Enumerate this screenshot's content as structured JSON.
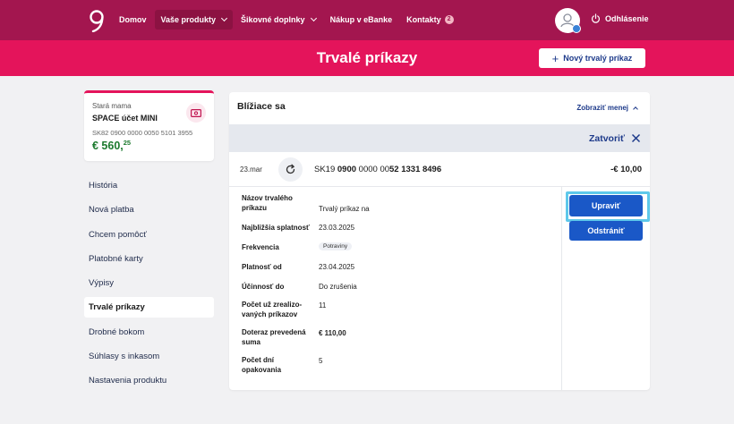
{
  "nav": {
    "items": [
      {
        "label": "Domov"
      },
      {
        "label": "Vaše produkty"
      },
      {
        "label": "Šikovné doplnky"
      },
      {
        "label": "Nákup v eBanke"
      },
      {
        "label": "Kontakty"
      }
    ],
    "contacts_badge": "2",
    "logout_label": "Odhlásenie"
  },
  "page": {
    "title": "Trvalé príkazy",
    "new_order_label": "Nový trvalý príkaz"
  },
  "account": {
    "nickname": "Stará mama",
    "name": "SPACE účet MINI",
    "iban": "SK82 0900 0000 0050 5101 3955",
    "balance_main": "€ 560,",
    "balance_cents": "25"
  },
  "sidebar": {
    "items": [
      {
        "label": "História"
      },
      {
        "label": "Nová platba"
      },
      {
        "label": "Chcem pomôcť"
      },
      {
        "label": "Platobné karty"
      },
      {
        "label": "Výpisy"
      },
      {
        "label": "Trvalé príkazy"
      },
      {
        "label": "Drobné bokom"
      },
      {
        "label": "Súhlasy s inkasom"
      },
      {
        "label": "Nastavenia produktu"
      }
    ]
  },
  "panel": {
    "title": "Blížiace sa",
    "show_less_label": "Zobraziť menej",
    "close_label": "Zatvoriť",
    "order": {
      "date": "23.mar",
      "iban_prefix": "SK19 ",
      "iban_bold1": "0900",
      "iban_mid": " 0000 00",
      "iban_bold2": "52 1331 8496",
      "amount": "-€ 10,00"
    },
    "details": [
      {
        "label": "Názov trvalého príkazu",
        "value": "Trvalý príkaz na"
      },
      {
        "label": "Najbližšia splatnosť",
        "value": "23.03.2025"
      },
      {
        "label": "Frekvencia",
        "value": "Potraviny"
      },
      {
        "label": "Platnosť od",
        "value": "23.04.2025"
      },
      {
        "label": "Účinnosť do",
        "value": "Do zrušenia"
      },
      {
        "label": "Počet už zrealizovaných príkazov",
        "label_line1": "Počet už zrealizo-",
        "label_line2": "vaných príkazov",
        "value": "11"
      },
      {
        "label": "Doteraz prevedená suma",
        "value": "€ 110,00"
      },
      {
        "label": "Počet dní opakovania",
        "value": "5"
      }
    ],
    "edit_label": "Upraviť",
    "delete_label": "Odstrániť"
  }
}
